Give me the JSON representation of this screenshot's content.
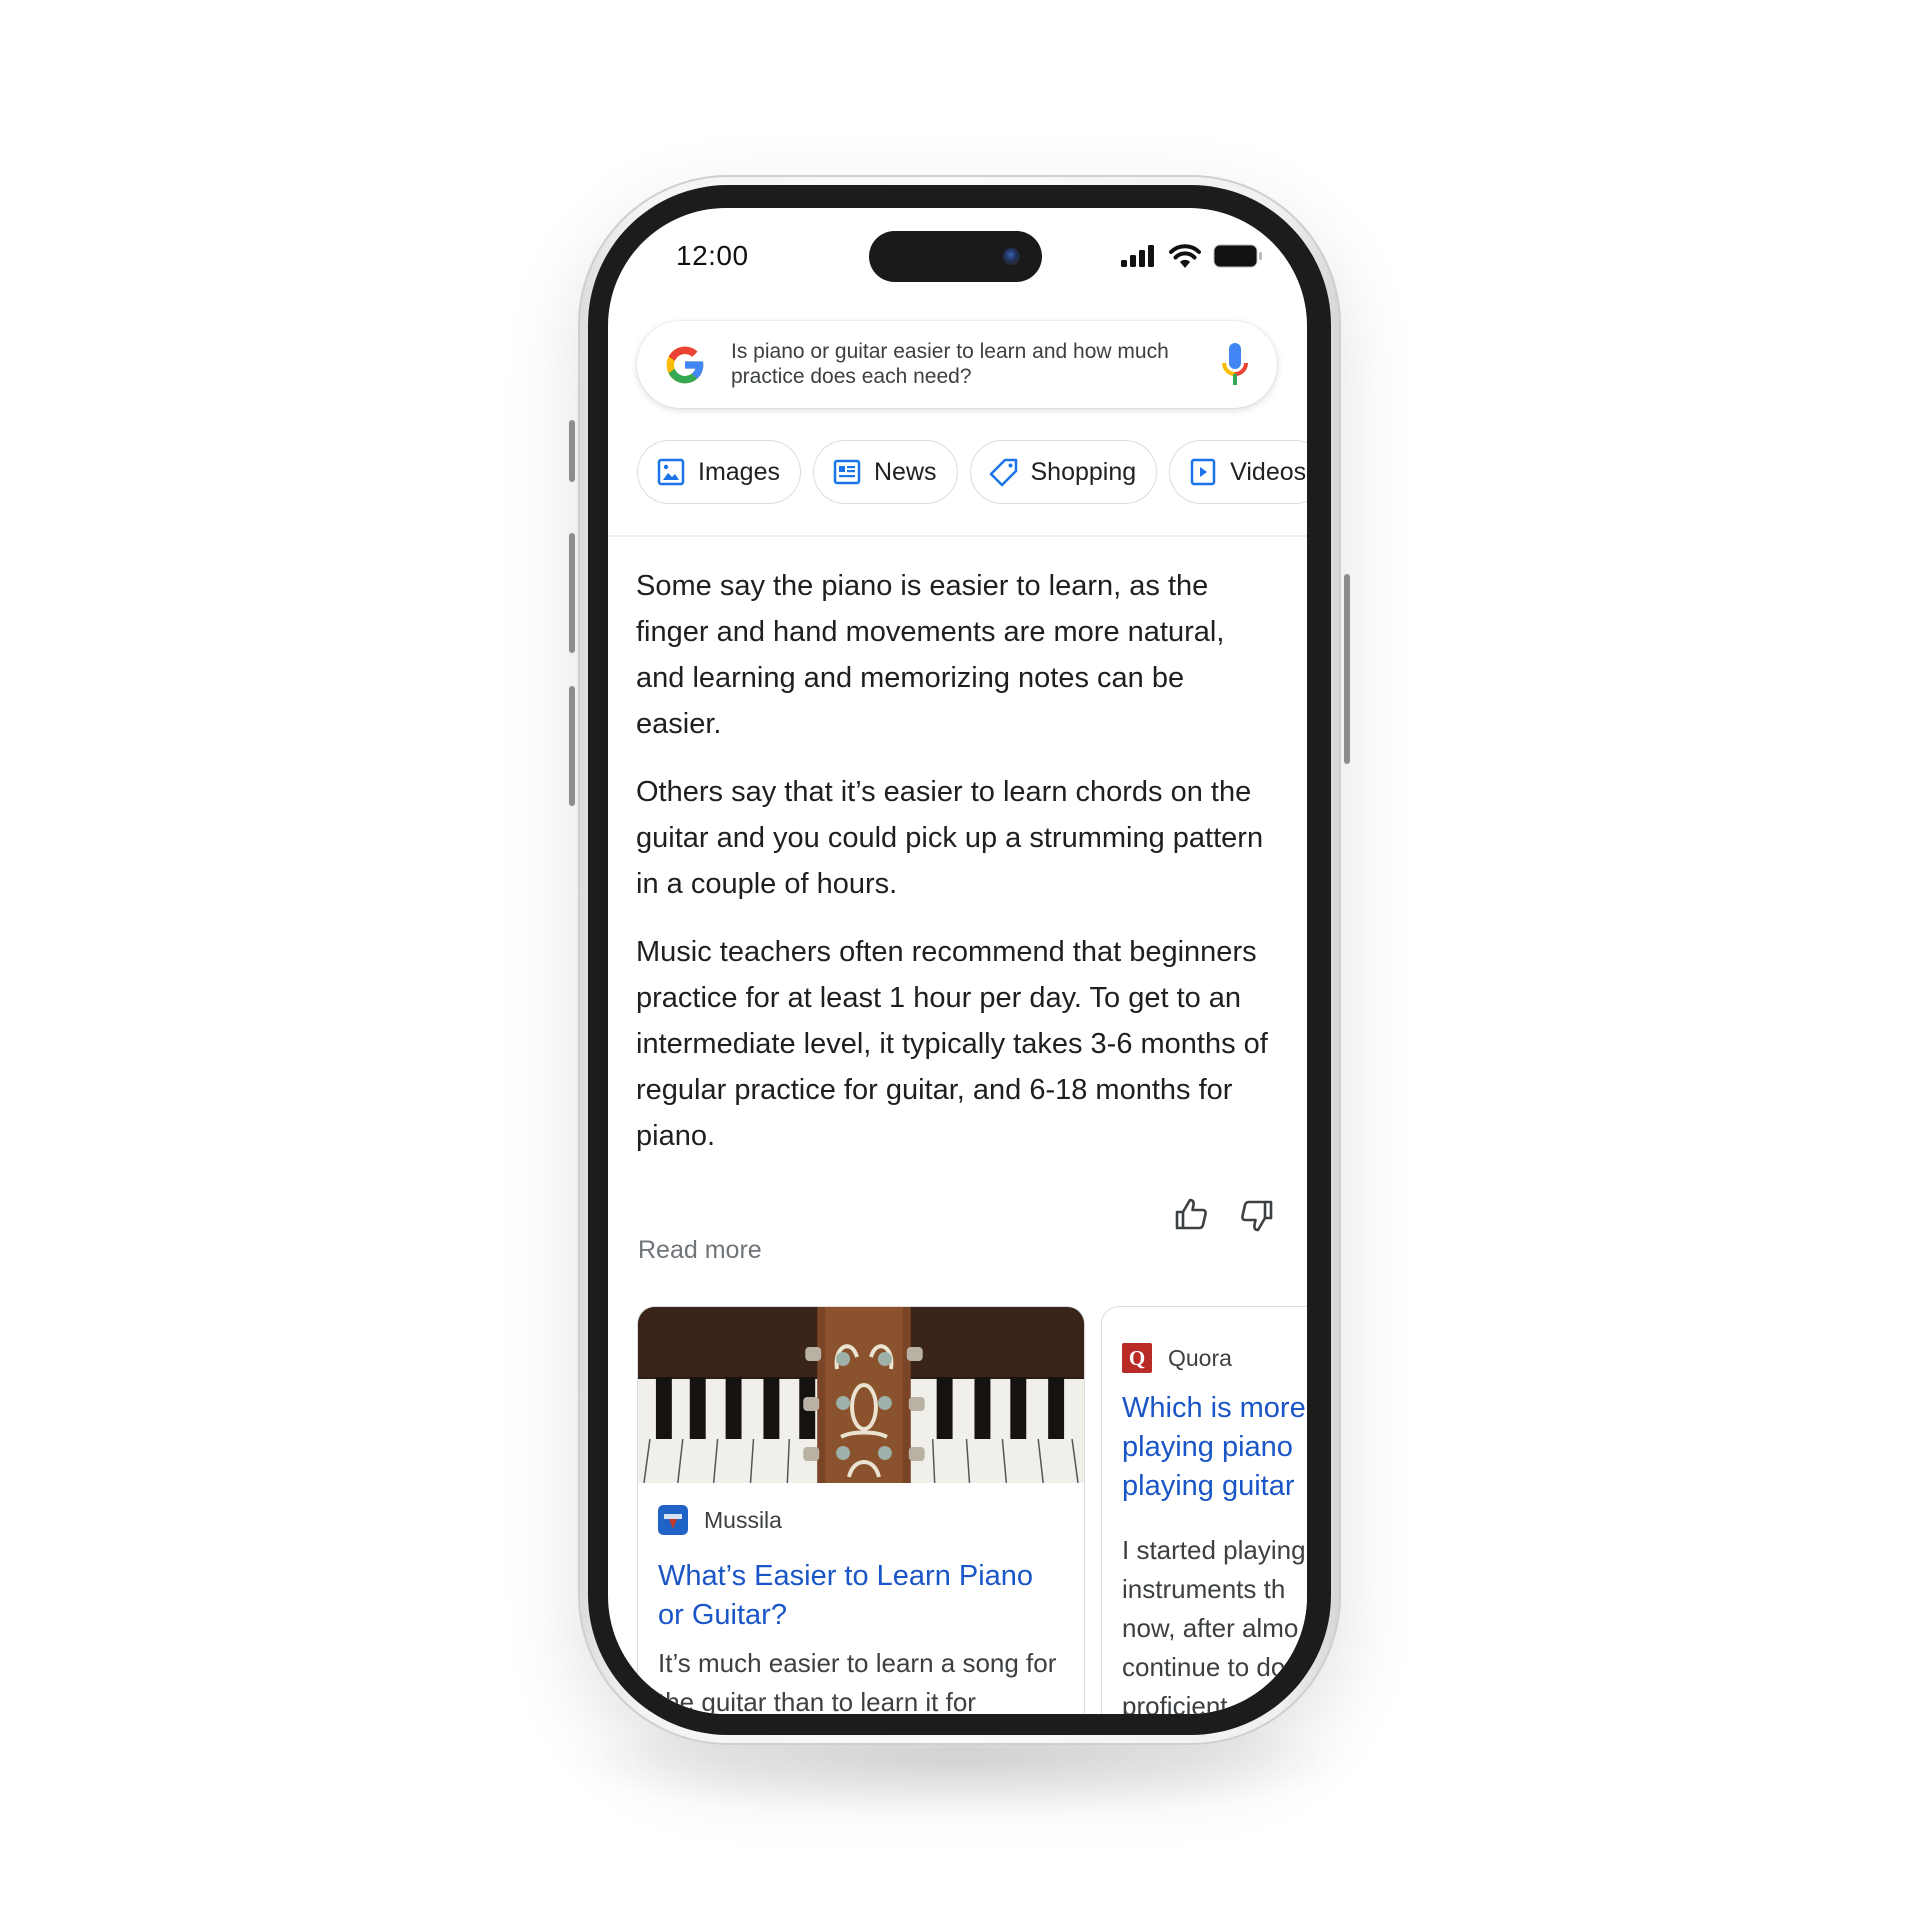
{
  "status_bar": {
    "time": "12:00",
    "icons": [
      "signal-icon",
      "wifi-icon",
      "battery-icon"
    ]
  },
  "search": {
    "query": "Is piano or guitar easier to learn and how much practice does each need?",
    "logo": "google-logo",
    "mic_icon": "mic-icon"
  },
  "chips": [
    {
      "label": "Images",
      "icon": "image-icon"
    },
    {
      "label": "News",
      "icon": "news-icon"
    },
    {
      "label": "Shopping",
      "icon": "tag-icon"
    },
    {
      "label": "Videos",
      "icon": "play-icon"
    }
  ],
  "colors": {
    "link_blue": "#1a56c7",
    "chip_icon_blue": "#1a73e8",
    "google_blue": "#4285F4",
    "google_red": "#EA4335",
    "google_yellow": "#FBBC05",
    "google_green": "#34A853",
    "quora_red": "#b92b27"
  },
  "answer": {
    "paragraphs": [
      "Some say the piano is easier to learn, as the finger and hand movements are more natural, and learning and memorizing notes can be easier.",
      "Others say that it’s easier to learn chords on the guitar and you could pick up a strumming pattern in a couple of hours.",
      "Music teachers often recommend that beginners practice for at least 1 hour per day. To get to an intermediate level, it typically takes 3-6 months of regular practice for guitar, and 6-18 months for piano."
    ],
    "feedback": {
      "thumbs_up": "thumbs-up-icon",
      "thumbs_down": "thumbs-down-icon"
    },
    "read_more": "Read more"
  },
  "cards": [
    {
      "source": "Mussila",
      "image": "guitar headstock resting on piano keys",
      "title": "What’s Easier to Learn Piano or Guitar?",
      "snippet": "It’s much easier to learn a song for the guitar than to learn it for"
    },
    {
      "source": "Quora",
      "title": "Which is more playing piano playing guitar",
      "snippet": "I started playing instruments th now, after almo continue to do proficient"
    }
  ]
}
